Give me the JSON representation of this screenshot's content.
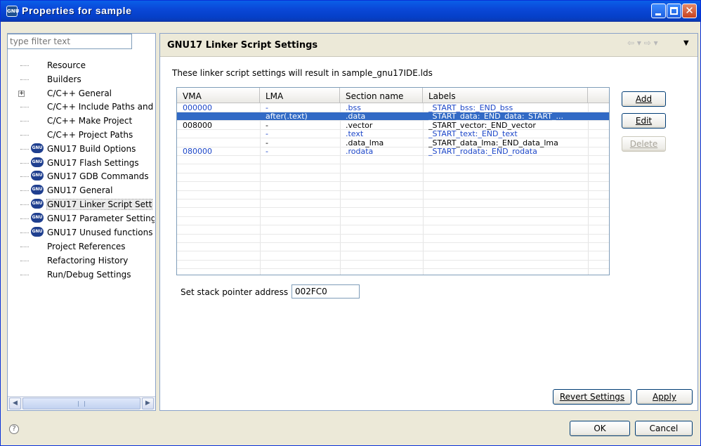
{
  "window": {
    "title": "Properties for sample",
    "icon_text": "GNU"
  },
  "left": {
    "filter_placeholder": "type filter text",
    "tree": [
      {
        "label": "Resource",
        "kind": "plain"
      },
      {
        "label": "Builders",
        "kind": "plain"
      },
      {
        "label": "C/C++ General",
        "kind": "expand"
      },
      {
        "label": "C/C++ Include Paths and",
        "kind": "plain"
      },
      {
        "label": "C/C++ Make Project",
        "kind": "plain"
      },
      {
        "label": "C/C++ Project Paths",
        "kind": "plain"
      },
      {
        "label": "GNU17 Build Options",
        "kind": "gnu"
      },
      {
        "label": "GNU17 Flash Settings",
        "kind": "gnu"
      },
      {
        "label": "GNU17 GDB Commands",
        "kind": "gnu"
      },
      {
        "label": "GNU17 General",
        "kind": "gnu"
      },
      {
        "label": "GNU17 Linker Script Sett",
        "kind": "gnu",
        "selected": true
      },
      {
        "label": "GNU17 Parameter Setting",
        "kind": "gnu"
      },
      {
        "label": "GNU17 Unused functions",
        "kind": "gnu"
      },
      {
        "label": "Project References",
        "kind": "plain"
      },
      {
        "label": "Refactoring History",
        "kind": "plain"
      },
      {
        "label": "Run/Debug Settings",
        "kind": "plain"
      }
    ],
    "gnu_icon_text": "GNU"
  },
  "right": {
    "title": "GNU17 Linker Script Settings",
    "nav_arrows": "⇦ ▾ ⇨ ▾",
    "nav_menu": "▼",
    "description": "These linker script settings will result in sample_gnu17IDE.lds",
    "table": {
      "columns": [
        "VMA",
        "LMA",
        "Section name",
        "Labels"
      ],
      "rows": [
        {
          "vma": "000000",
          "lma": "-",
          "section": ".bss",
          "labels": "_START_bss:_END_bss",
          "blue": true
        },
        {
          "vma": "",
          "lma": "after(.text)",
          "section": ".data",
          "labels": "_START_data:_END_data:_START_...",
          "selected": true
        },
        {
          "vma": "008000",
          "lma": "-",
          "section": ".vector",
          "labels": "_START_vector:_END_vector"
        },
        {
          "vma": "",
          "lma": "-",
          "section": ".text",
          "labels": "_START_text:_END_text",
          "blue": true
        },
        {
          "vma": "",
          "lma": "-",
          "section": ".data_lma",
          "labels": "_START_data_lma:_END_data_lma"
        },
        {
          "vma": "080000",
          "lma": "-",
          "section": ".rodata",
          "labels": "_START_rodata:_END_rodata",
          "blue": true
        }
      ]
    },
    "buttons": {
      "add": "Add",
      "edit": "Edit",
      "delete": "Delete"
    },
    "stack_pointer_label": "Set stack pointer address",
    "stack_pointer_value": "002FC0",
    "revert": "Revert Settings",
    "apply": "Apply"
  },
  "footer": {
    "help": "?",
    "ok": "OK",
    "cancel": "Cancel"
  },
  "colors": {
    "selection": "#316ac5",
    "blue_text": "#1c46c8",
    "titlebar": "#0a48d8"
  }
}
